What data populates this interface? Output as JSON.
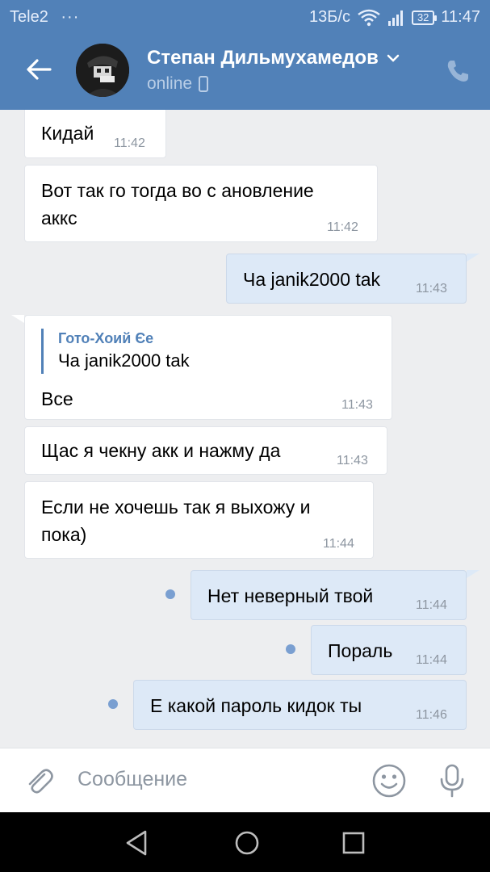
{
  "status_bar": {
    "carrier": "Tele2",
    "dots": "···",
    "speed": "13Б/с",
    "battery": "32",
    "time": "11:47"
  },
  "header": {
    "contact_name": "Степан Дильмухамедов",
    "presence": "online"
  },
  "messages": [
    {
      "text": "Кидай",
      "time": "11:42"
    },
    {
      "text_line1": "Вот так го тогда во с ановление",
      "text_line2": "аккс",
      "time": "11:42"
    },
    {
      "text": "Ча janik2000 tak",
      "time": "11:43"
    },
    {
      "quote_author": "Гото-Хоий Єе",
      "quote_text": "Ча janik2000 tak",
      "text": "Все",
      "time": "11:43"
    },
    {
      "text": "Щас я чекну акк и нажму да",
      "time": "11:43"
    },
    {
      "text_line1": "Если не хочешь так я выхожу и",
      "text_line2": "пока)",
      "time": "11:44"
    },
    {
      "text": "Нет неверный твой",
      "time": "11:44"
    },
    {
      "text": "Пораль",
      "time": "11:44"
    },
    {
      "text": "Е какой пароль кидок ты",
      "time": "11:46"
    }
  ],
  "input": {
    "placeholder": "Сообщение"
  },
  "colors": {
    "header_blue": "#5181b8",
    "outgoing_bubble": "#dde9f7",
    "incoming_bubble": "#ffffff",
    "unread_dot": "#7a9fd1"
  },
  "icons": [
    "back-arrow-icon",
    "chevron-down-icon",
    "mobile-icon",
    "phone-icon",
    "paperclip-icon",
    "smile-icon",
    "microphone-icon",
    "nav-back-icon",
    "nav-home-icon",
    "nav-recent-icon"
  ]
}
